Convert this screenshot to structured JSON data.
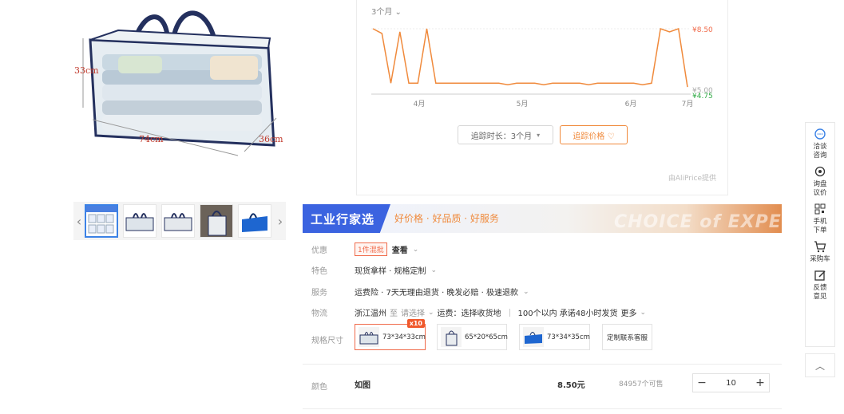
{
  "product_image": {
    "dim_height": "33cm",
    "dim_width": "74cm",
    "dim_depth": "36cm"
  },
  "thumbnails": {
    "prev_symbol": "‹",
    "next_symbol": "›",
    "count": 5
  },
  "price_chart": {
    "period": "3个月 ⌄",
    "max_price": "¥8.50",
    "min_price": "¥4.75",
    "mid_price": "¥5.00",
    "track_duration": "追踪时长：3个月",
    "track_price_button": "追踪价格 ♡",
    "provider": "由AliPrice提供",
    "chart_data": {
      "type": "line",
      "x": [
        "4月",
        "5月",
        "6月",
        "7月"
      ],
      "series": [
        {
          "values": [
            8.5,
            8.2,
            5.0,
            8.3,
            5.0,
            5.0,
            8.5,
            5.0,
            5.0,
            5.0,
            5.0,
            5.0,
            5.0,
            5.0,
            5.0,
            4.9,
            5.0,
            5.0,
            5.0,
            4.9,
            5.0,
            5.0,
            5.0,
            5.0,
            4.9,
            5.0,
            5.0,
            5.0,
            5.0,
            5.0,
            4.9,
            5.0,
            8.5,
            8.3,
            8.5,
            4.75
          ]
        }
      ],
      "color": "#f08a3c"
    }
  },
  "banner": {
    "badge": "工业行家选",
    "slogan": "好价格 · 好品质 · 好服务",
    "english": "CHOICE of EXPERT"
  },
  "details": {
    "discount": {
      "label": "优惠",
      "tag": "1件混批",
      "action": "查看"
    },
    "feature": {
      "label": "特色",
      "value": "现货拿样 · 规格定制"
    },
    "service": {
      "label": "服务",
      "value": "运费险 · 7天无理由退货 · 晚发必赔 · 极速退款"
    },
    "logistics": {
      "label": "物流",
      "origin": "浙江温州",
      "to": "至",
      "select": "请选择",
      "shipping": "运费：选择收货地",
      "promise": "100个以内 承诺48小时发货",
      "more": "更多"
    },
    "spec": {
      "label": "规格尺寸",
      "options": [
        "73*34*33cm",
        "65*20*65cm",
        "73*34*35cm",
        "定制联系客服"
      ],
      "selected_badge": "x10"
    }
  },
  "order": {
    "color_label": "颜色",
    "color_value": "如图",
    "price": "8.50元",
    "stock": "84957个可售",
    "minus": "−",
    "quantity": "10",
    "plus": "+"
  },
  "sidebar": {
    "items": [
      {
        "icon": "chat-icon",
        "label": "洽谈\n咨询"
      },
      {
        "icon": "bargain-icon",
        "label": "询盘\n议价"
      },
      {
        "icon": "qrcode-icon",
        "label": "手机\n下单"
      },
      {
        "icon": "cart-icon",
        "label": "采购车"
      },
      {
        "icon": "feedback-icon",
        "label": "反馈\n意见"
      }
    ],
    "top_symbol": "︿"
  }
}
